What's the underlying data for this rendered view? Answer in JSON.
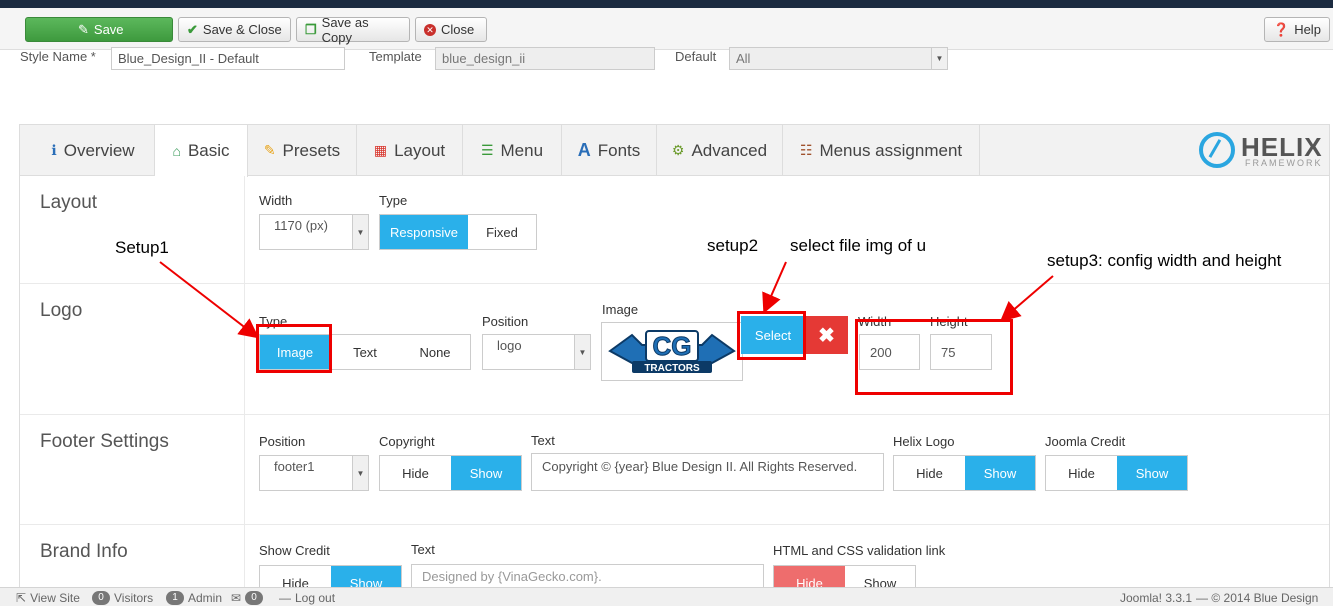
{
  "toolbar": {
    "save": "Save",
    "save_close": "Save & Close",
    "save_copy": "Save as Copy",
    "close": "Close",
    "help": "Help"
  },
  "style": {
    "style_name_label": "Style Name *",
    "style_name_value": "Blue_Design_II - Default",
    "template_label": "Template",
    "template_value": "blue_design_ii",
    "default_label": "Default",
    "default_value": "All"
  },
  "tabs": [
    {
      "label": "Overview",
      "icon": "info-icon"
    },
    {
      "label": "Basic",
      "icon": "home-icon"
    },
    {
      "label": "Presets",
      "icon": "pencil-icon"
    },
    {
      "label": "Layout",
      "icon": "grid-icon"
    },
    {
      "label": "Menu",
      "icon": "list-icon"
    },
    {
      "label": "Fonts",
      "icon": "font-icon"
    },
    {
      "label": "Advanced",
      "icon": "gear-icon"
    },
    {
      "label": "Menus assignment",
      "icon": "list-alt-icon"
    }
  ],
  "brand_logo": {
    "word": "HELIX",
    "sub": "FRAMEWORK"
  },
  "sections": {
    "layout": {
      "title": "Layout",
      "width_label": "Width",
      "width_value": "1170 (px)",
      "type_label": "Type",
      "type_options": [
        "Responsive",
        "Fixed"
      ]
    },
    "logo": {
      "title": "Logo",
      "type_label": "Type",
      "type_options": [
        "Image",
        "Text",
        "None"
      ],
      "position_label": "Position",
      "position_value": "logo",
      "image_label": "Image",
      "select_button": "Select",
      "remove_icon": "✖",
      "width_label": "Width",
      "width_value": "200",
      "height_label": "Height",
      "height_value": "75",
      "logo_text_main": "CG",
      "logo_text_sub": "TRACTORS"
    },
    "footer": {
      "title": "Footer Settings",
      "position_label": "Position",
      "position_value": "footer1",
      "copyright_label": "Copyright",
      "hide": "Hide",
      "show": "Show",
      "text_label": "Text",
      "text_value": "Copyright ©  {year} Blue Design II. All Rights Reserved.",
      "helix_logo_label": "Helix Logo",
      "joomla_credit_label": "Joomla Credit"
    },
    "brand": {
      "title": "Brand Info",
      "show_credit_label": "Show Credit",
      "text_label": "Text",
      "text_placeholder": "Designed by {VinaGecko.com}.",
      "validation_label": "HTML and CSS validation link",
      "hide": "Hide",
      "show": "Show"
    }
  },
  "annotations": {
    "setup1": "Setup1",
    "setup2": "setup2",
    "setup2_note": "select file img of u",
    "setup3": "setup3: config width and height"
  },
  "statusbar": {
    "view_site": "View Site",
    "visitors_count": "0",
    "visitors": "Visitors",
    "admin_count": "1",
    "admin": "Admin",
    "messages_count": "0",
    "logout": "Log out",
    "version": "Joomla! 3.3.1",
    "copyright": "— © 2014 Blue Design"
  },
  "colors": {
    "accent": "#2ab0ea",
    "save_green": "#5cb85c",
    "danger": "#e53935",
    "annotation": "#e00000"
  }
}
